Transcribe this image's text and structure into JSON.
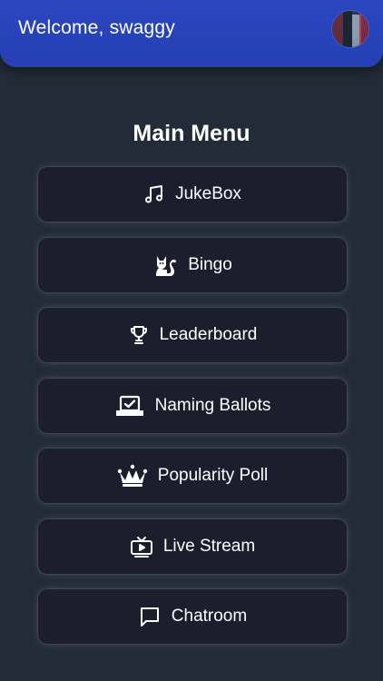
{
  "header": {
    "welcome_text": "Welcome, swaggy"
  },
  "main": {
    "title": "Main Menu",
    "items": [
      {
        "label": "JukeBox",
        "icon": "music-note-icon"
      },
      {
        "label": "Bingo",
        "icon": "cat-icon"
      },
      {
        "label": "Leaderboard",
        "icon": "trophy-icon"
      },
      {
        "label": "Naming Ballots",
        "icon": "ballot-box-icon"
      },
      {
        "label": "Popularity Poll",
        "icon": "crown-icon"
      },
      {
        "label": "Live Stream",
        "icon": "tv-play-icon"
      },
      {
        "label": "Chatroom",
        "icon": "chat-bubble-icon"
      }
    ]
  },
  "colors": {
    "header_bg": "#2440b3",
    "page_bg": "#222b37",
    "button_bg": "#1c1e2d"
  }
}
